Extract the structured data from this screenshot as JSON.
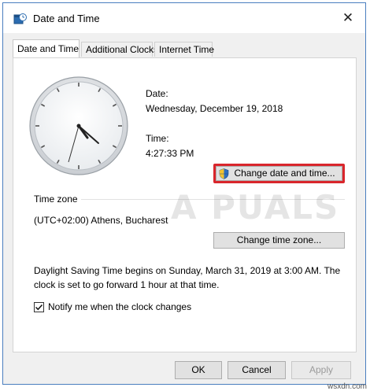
{
  "window": {
    "title": "Date and Time",
    "close_glyph": "✕"
  },
  "tabs": [
    {
      "label": "Date and Time"
    },
    {
      "label": "Additional Clocks"
    },
    {
      "label": "Internet Time"
    }
  ],
  "datetime": {
    "date_label": "Date:",
    "date_value": "Wednesday, December 19, 2018",
    "time_label": "Time:",
    "time_value": "4:27:33 PM",
    "change_button": "Change date and time..."
  },
  "timezone": {
    "section_label": "Time zone",
    "value": "(UTC+02:00) Athens, Bucharest",
    "change_button": "Change time zone..."
  },
  "dst": {
    "line1": "Daylight Saving Time begins on Sunday, March 31, 2019 at 3:00 AM. The",
    "line2": "clock is set to go forward 1 hour at that time."
  },
  "notify": {
    "label": "Notify me when the clock changes",
    "checked": true
  },
  "footer": {
    "ok": "OK",
    "cancel": "Cancel",
    "apply": "Apply"
  },
  "watermark": {
    "text": "A PUALS"
  },
  "site_watermark": "wsxdn.com"
}
